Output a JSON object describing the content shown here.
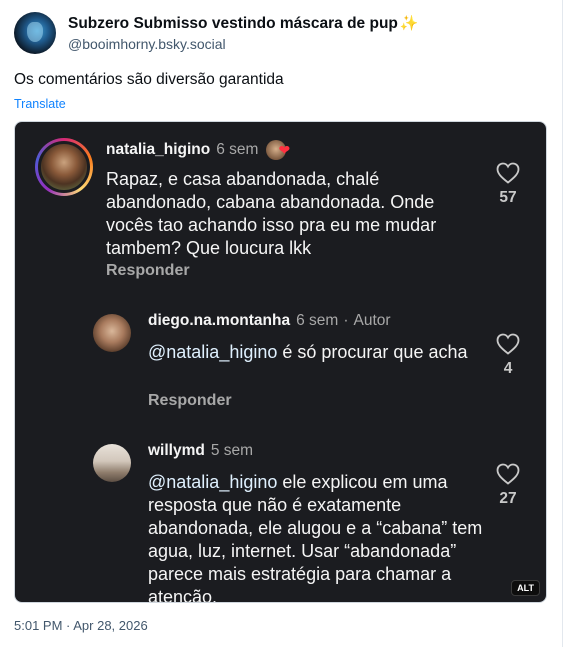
{
  "post": {
    "display_name": "Subzero Submisso vestindo máscara de pup",
    "display_name_emoji": "✨",
    "handle": "@booimhorny.bsky.social",
    "text": "Os comentários são diversão garantida",
    "translate_label": "Translate",
    "timestamp": "5:01 PM · Apr 28, 2026",
    "alt_badge": "ALT"
  },
  "screenshot": {
    "comments": [
      {
        "username": "natalia_higino",
        "time": "6 sem",
        "body": "Rapaz, e casa abandonada, chalé abandonado, cabana abandonada. Onde vocês tao achando isso pra eu me mudar tambem? Que loucura lkk",
        "reply_label": "Responder",
        "likes": "57",
        "badge_emoji": "❤"
      },
      {
        "username": "diego.na.montanha",
        "time": "6 sem",
        "separator": "·",
        "tag": "Autor",
        "mention": "@natalia_higino",
        "body": " é só procurar que acha",
        "reply_label": "Responder",
        "likes": "4"
      },
      {
        "username": "willymd",
        "time": "5 sem",
        "mention": "@natalia_higino",
        "body": " ele explicou em uma resposta que não é exatamente abandonada, ele alugou e a “cabana” tem agua, luz, internet. Usar “abandonada” parece mais estratégia para chamar a atenção.",
        "likes": "27"
      }
    ]
  }
}
